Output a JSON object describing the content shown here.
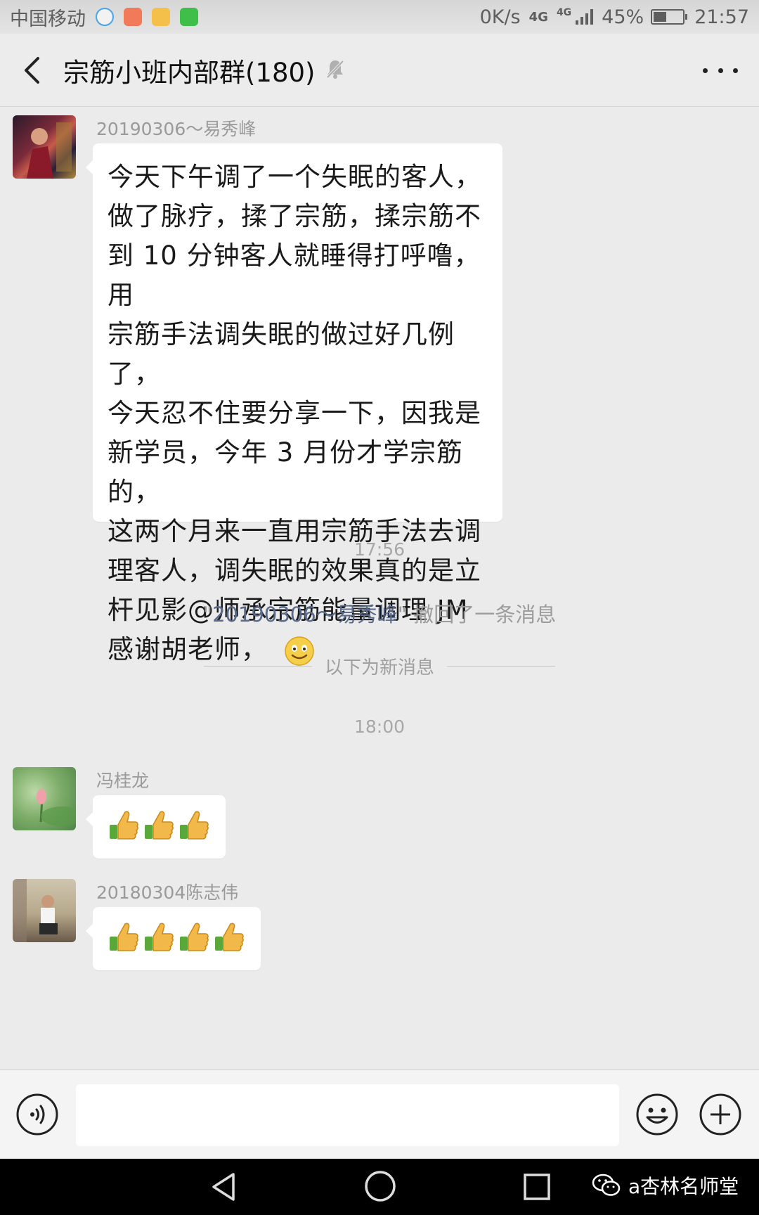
{
  "status_bar": {
    "carrier": "中国移动",
    "speed": "0K/s",
    "network": "4G",
    "network2": "4G",
    "battery": "45%",
    "battery_level": 0.45,
    "time": "21:57"
  },
  "header": {
    "title": "宗筋小班内部群(180)"
  },
  "messages": [
    {
      "sender": "20190306～易秀峰",
      "lines": [
        "今天下午调了一个失眠的客人，",
        "做了脉疗，揉了宗筋，揉宗筋不",
        "到 10 分钟客人就睡得打呼噜，用",
        "宗筋手法调失眠的做过好几例了，",
        "今天忍不住要分享一下，因我是",
        "新学员，今年 3 月份才学宗筋的，",
        "这两个月来一直用宗筋手法去调",
        "理客人，调失眠的效果真的是立",
        "杆见影@师承宗筋能量调理 JM",
        "感谢胡老师，"
      ]
    },
    {
      "sender": "冯桂龙",
      "thumbs": 3
    },
    {
      "sender": "20180304陈志伟",
      "thumbs": 4
    }
  ],
  "time_1": "17:56",
  "recall": {
    "quote_open": "\"",
    "who": "20190306～易秀峰",
    "rest": "\" 撤回了一条消息"
  },
  "new_divider": "以下为新消息",
  "time_2": "18:00",
  "watermark": "a杏林名师堂",
  "colors": {
    "background": "#ebebeb",
    "bubble": "#ffffff",
    "recall_name": "#5a6a8a"
  }
}
